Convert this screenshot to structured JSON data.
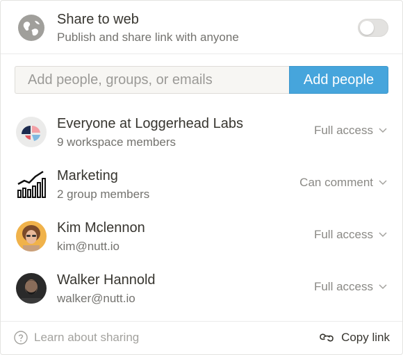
{
  "share_web": {
    "title": "Share to web",
    "subtitle": "Publish and share link with anyone",
    "toggle_on": false,
    "icon": "globe-icon"
  },
  "invite": {
    "placeholder": "Add people, groups, or emails",
    "button_label": "Add people"
  },
  "members": [
    {
      "name": "Everyone at Loggerhead Labs",
      "detail": "9 workspace members",
      "access": "Full access",
      "avatar": "workspace-logo"
    },
    {
      "name": "Marketing",
      "detail": "2 group members",
      "access": "Can comment",
      "avatar": "bar-chart-icon"
    },
    {
      "name": "Kim Mclennon",
      "detail": "kim@nutt.io",
      "access": "Full access",
      "avatar": "user-photo"
    },
    {
      "name": "Walker Hannold",
      "detail": "walker@nutt.io",
      "access": "Full access",
      "avatar": "user-photo"
    }
  ],
  "footer": {
    "learn_label": "Learn about sharing",
    "copy_label": "Copy link"
  },
  "colors": {
    "accent": "#46a5dc",
    "text": "#37352f",
    "muted": "#73726e"
  }
}
